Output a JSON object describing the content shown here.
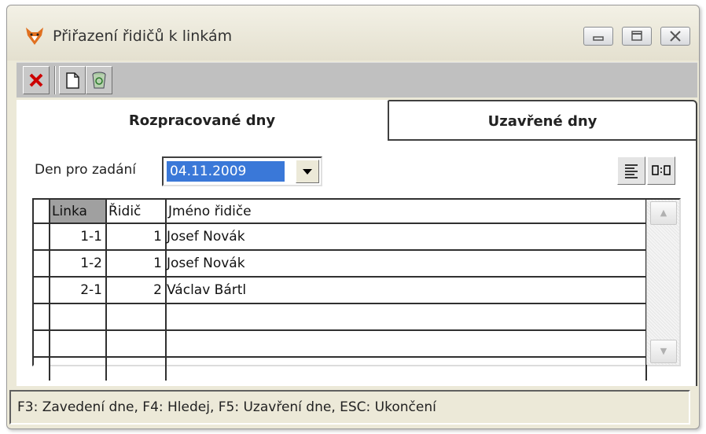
{
  "window": {
    "title": "Přiřazení řidičů k linkám",
    "icon": "fox-icon"
  },
  "toolbar": {
    "items": [
      "close-x-icon",
      "new-document-icon",
      "recycle-bin-icon"
    ]
  },
  "tabs": [
    {
      "label": "Rozpracované dny",
      "active": true
    },
    {
      "label": "Uzavřené dny",
      "active": false
    }
  ],
  "filter": {
    "label": "Den pro zadání",
    "value": "04.11.2009"
  },
  "grid": {
    "columns": [
      "Linka",
      "Řidič",
      "Jméno řidiče"
    ],
    "rows": [
      {
        "linka": "1-1",
        "ridic": "1",
        "jmeno": "Josef Novák"
      },
      {
        "linka": "1-2",
        "ridic": "1",
        "jmeno": "Josef Novák"
      },
      {
        "linka": "2-1",
        "ridic": "2",
        "jmeno": "Václav Bártl"
      },
      {
        "linka": "",
        "ridic": "",
        "jmeno": ""
      },
      {
        "linka": "",
        "ridic": "",
        "jmeno": ""
      },
      {
        "linka": "",
        "ridic": "",
        "jmeno": ""
      }
    ]
  },
  "status": "F3: Zavedení dne, F4: Hledej, F5: Uzavření dne, ESC: Ukončení",
  "colors": {
    "selection": "#3a78d8",
    "header_selected": "#a0a0a0",
    "delete_red": "#cc0000"
  }
}
